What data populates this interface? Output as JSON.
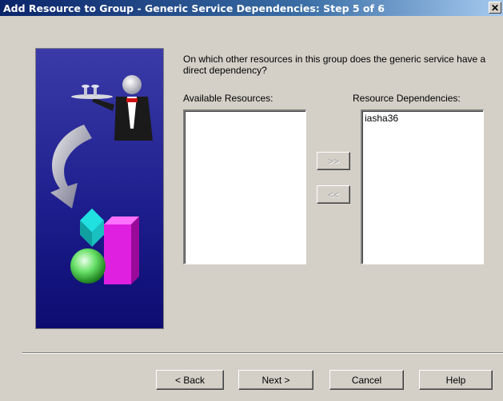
{
  "window": {
    "title": "Add Resource to Group - Generic Service Dependencies:  Step 5 of 6",
    "close_glyph": "✕"
  },
  "prompt": "On which other resources in this group does the generic service have a direct dependency?",
  "available": {
    "label": "Available Resources:",
    "items": []
  },
  "dependencies": {
    "label": "Resource Dependencies:",
    "items": [
      "iasha36"
    ]
  },
  "move_buttons": {
    "add_label": ">>",
    "remove_label": "<<"
  },
  "footer": {
    "back_label": "< Back",
    "next_label": "Next >",
    "cancel_label": "Cancel",
    "help_label": "Help"
  },
  "colors": {
    "dialog_bg": "#d4d0c8",
    "image_bg": "#000080",
    "titlebar_start": "#0a246a"
  },
  "icons": {
    "wizard_image": "butler-arrow-shapes-illustration",
    "close": "close-icon"
  }
}
